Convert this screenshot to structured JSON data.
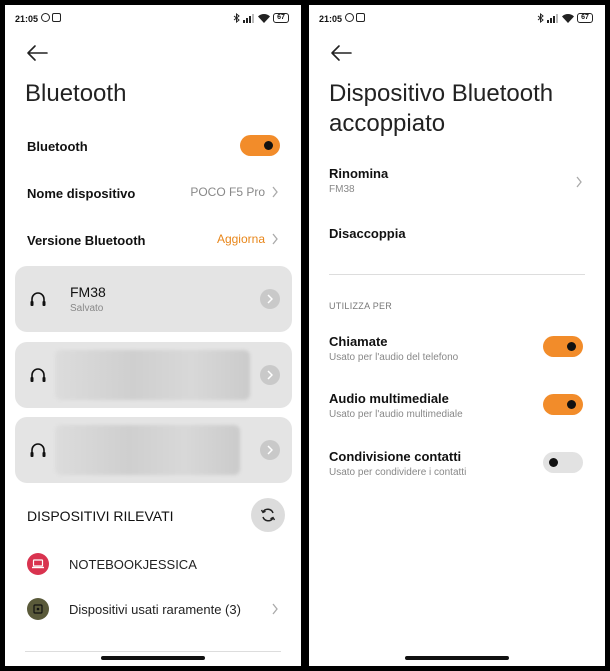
{
  "status_bar": {
    "time": "21:05",
    "battery": "67"
  },
  "left": {
    "title": "Bluetooth",
    "bluetooth_row": {
      "label": "Bluetooth",
      "enabled": true
    },
    "device_name_row": {
      "label": "Nome dispositivo",
      "value": "POCO F5 Pro"
    },
    "version_row": {
      "label": "Versione Bluetooth",
      "value": "Aggiorna"
    },
    "paired_devices": [
      {
        "name": "FM38",
        "status": "Salvato",
        "icon": "headphones-icon"
      },
      {
        "name": "",
        "status": "",
        "icon": "headphones-icon",
        "blurred": true
      },
      {
        "name": "",
        "status": "",
        "icon": "headphones-icon",
        "blurred": true
      }
    ],
    "detected_header": "DISPOSITIVI RILEVATI",
    "detected": [
      {
        "name": "NOTEBOOKJESSICA",
        "icon": "laptop-icon",
        "color": "#d9334f"
      },
      {
        "name": "Dispositivi usati raramente (3)",
        "icon": "device-icon",
        "color": "#5a5a3a"
      }
    ]
  },
  "right": {
    "title_line1": "Dispositivo Bluetooth",
    "title_line2": "accoppiato",
    "rename": {
      "label": "Rinomina",
      "value": "FM38"
    },
    "unpair": {
      "label": "Disaccoppia"
    },
    "use_for_header": "UTILIZZA PER",
    "options": [
      {
        "title": "Chiamate",
        "subtitle": "Usato per l'audio del telefono",
        "enabled": true
      },
      {
        "title": "Audio multimediale",
        "subtitle": "Usato per l'audio multimediale",
        "enabled": true
      },
      {
        "title": "Condivisione contatti",
        "subtitle": "Usato per condividere i contatti",
        "enabled": false
      }
    ]
  },
  "colors": {
    "accent": "#f28c2a",
    "accent_text": "#e8861a",
    "card_bg": "#e4e4e4"
  }
}
